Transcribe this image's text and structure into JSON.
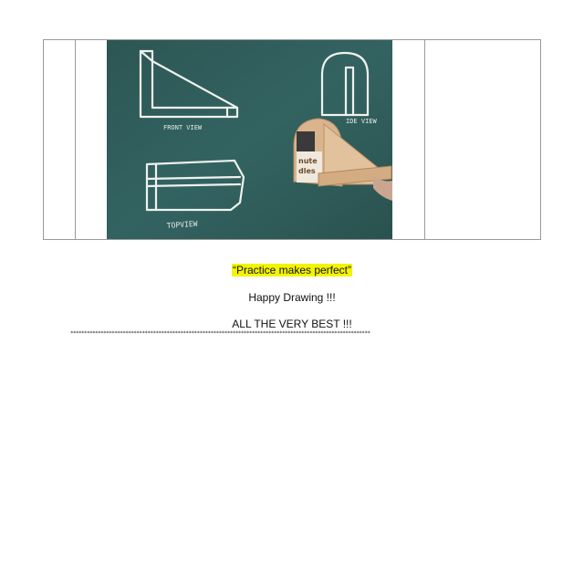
{
  "document": {
    "photo": {
      "labels": {
        "front_view": "FRONT VIEW",
        "side_view": "IDE VIEW",
        "top_view": "TOPVIEW",
        "card_brand": "nute",
        "card_text_2": "dles"
      }
    },
    "quote": "“Practice makes perfect”",
    "happy_drawing": "Happy Drawing !!!",
    "closing": "ALL THE VERY BEST !!!",
    "separator": "*************************************************************************************************************"
  },
  "colors": {
    "chalkboard": "#2f5a58",
    "chalk": "#eef2ee",
    "highlight": "#f4f400",
    "cardboard": "#d9b48c"
  }
}
